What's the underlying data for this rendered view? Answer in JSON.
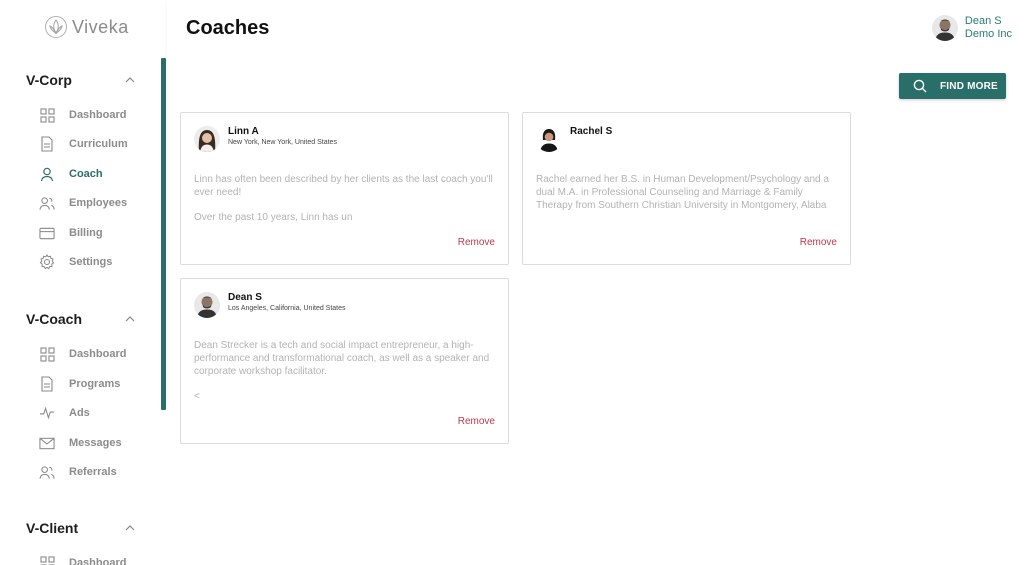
{
  "app": {
    "logo_text": "Viveka"
  },
  "header": {
    "title": "Coaches"
  },
  "user": {
    "name": "Dean S",
    "company": "Demo Inc"
  },
  "sidebar": {
    "sections": [
      {
        "title": "V-Corp",
        "items": [
          {
            "label": "Dashboard",
            "icon": "grid-icon"
          },
          {
            "label": "Curriculum",
            "icon": "document-icon"
          },
          {
            "label": "Coach",
            "icon": "person-icon"
          },
          {
            "label": "Employees",
            "icon": "people-icon"
          },
          {
            "label": "Billing",
            "icon": "credit-card-icon"
          },
          {
            "label": "Settings",
            "icon": "gear-icon"
          }
        ]
      },
      {
        "title": "V-Coach",
        "items": [
          {
            "label": "Dashboard",
            "icon": "grid-icon"
          },
          {
            "label": "Programs",
            "icon": "document-icon"
          },
          {
            "label": "Ads",
            "icon": "pulse-icon"
          },
          {
            "label": "Messages",
            "icon": "mail-icon"
          },
          {
            "label": "Referrals",
            "icon": "people-icon"
          }
        ]
      },
      {
        "title": "V-Client",
        "items": [
          {
            "label": "Dashboard",
            "icon": "grid-icon"
          }
        ]
      }
    ],
    "active_item": "Coach"
  },
  "main": {
    "find_more_label": "FIND MORE",
    "coaches": [
      {
        "name": "Linn A",
        "location": "New York, New York, United States",
        "bio": [
          "Linn has often been described by her clients as the last coach you'll ever need!",
          "Over the past 10 years, Linn has un"
        ],
        "remove_label": "Remove"
      },
      {
        "name": "Rachel S",
        "location": "",
        "bio": [
          "Rachel earned her B.S. in Human Development/Psychology and a dual M.A. in Professional Counseling and Marriage & Family Therapy from Southern Christian University in Montgomery, Alaba"
        ],
        "remove_label": "Remove"
      },
      {
        "name": "Dean S",
        "location": "Los Angeles, California, United States",
        "bio": [
          "Dean Strecker is a tech and social impact entrepreneur, a high-performance and transformational coach, as well as a speaker and corporate workshop facilitator.",
          "<"
        ],
        "remove_label": "Remove"
      }
    ]
  },
  "colors": {
    "accent": "#2a6e6a",
    "remove": "#c0394b",
    "muted_text": "#b3b3b3"
  }
}
